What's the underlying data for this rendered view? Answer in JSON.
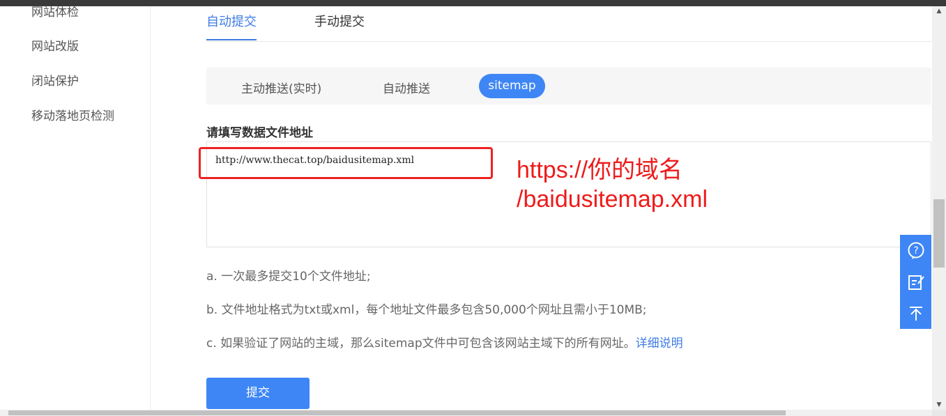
{
  "sidebar": {
    "items": [
      "网站体检",
      "网站改版",
      "闭站保护",
      "移动落地页检测"
    ]
  },
  "tabs": {
    "auto": "自动提交",
    "manual": "手动提交"
  },
  "subtabs": {
    "active_push": "主动推送(实时)",
    "auto_push": "自动推送",
    "sitemap": "sitemap"
  },
  "form": {
    "label": "请填写数据文件地址",
    "value": "http://www.thecat.top/baidusitemap.xml"
  },
  "annotation": {
    "line1": "https://你的域名",
    "line2": "/baidusitemap.xml"
  },
  "notes": {
    "a": "a. 一次最多提交10个文件地址;",
    "b": "b. 文件地址格式为txt或xml，每个地址文件最多包含50,000个网址且需小于10MB;",
    "c": "c. 如果验证了网站的主域，那么sitemap文件中可包含该网站主域下的所有网址。",
    "c_link": "详细说明"
  },
  "submit_label": "提交",
  "float_icons": [
    "help-icon",
    "feedback-icon",
    "back-to-top-icon"
  ],
  "colors": {
    "accent": "#3e86f5",
    "annotation_red": "#ee1b1b"
  }
}
